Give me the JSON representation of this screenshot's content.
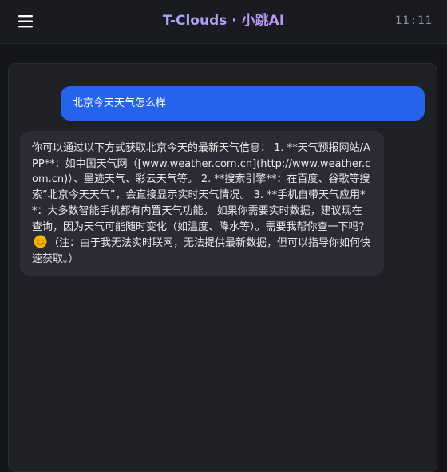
{
  "header": {
    "title": "T-Clouds · 小跳AI",
    "time": "11:11",
    "menu_icon": "hamburger-menu-icon"
  },
  "chat": {
    "messages": [
      {
        "role": "user",
        "text": "北京今天天气怎么样"
      },
      {
        "role": "assistant",
        "text_before_emoji": "你可以通过以下方式获取北京今天的最新天气信息： 1. **天气预报网站/APP**：如中国天气网（[www.weather.com.cn](http://www.weather.com.cn)）、墨迹天气、彩云天气等。 2. **搜索引擎**：在百度、谷歌等搜索“北京今天天气”，会直接显示实时天气情况。 3. **手机自带天气应用**：大多数智能手机都有内置天气功能。 如果你需要实时数据，建议现在查询，因为天气可能随时变化（如温度、降水等）。需要我帮你查一下吗？",
        "emoji_icon": "smiling-face-emoji-icon",
        "text_after_emoji": "（注：由于我无法实时联网，无法提供最新数据，但可以指导你如何快速获取。）"
      }
    ]
  },
  "colors": {
    "background": "#141519",
    "user_bubble": "#2563eb",
    "assistant_bubble": "#2b2c33",
    "title_gradient_start": "#8ab4ff",
    "title_gradient_end": "#e07cf0"
  }
}
